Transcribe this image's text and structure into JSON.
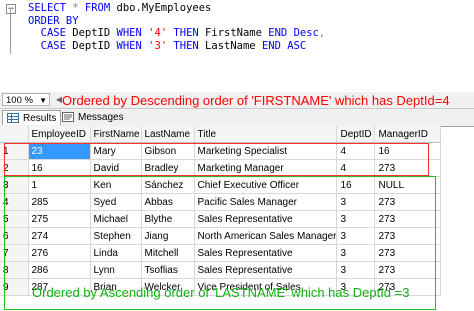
{
  "editor": {
    "line1": [
      "SELECT ",
      "*",
      " FROM ",
      "dbo.MyEmployees"
    ],
    "line2": [
      "ORDER BY"
    ],
    "line3": [
      "  CASE ",
      "DeptID ",
      "WHEN ",
      "'4'",
      " THEN ",
      "FirstName ",
      "END ",
      "Desc",
      ","
    ],
    "line4": [
      "  CASE ",
      "DeptID ",
      "WHEN ",
      "'3'",
      " THEN ",
      "LastName ",
      "END ",
      "ASC"
    ]
  },
  "toolbar": {
    "zoom": "100 %"
  },
  "tabs": [
    {
      "label": "Results",
      "icon": "grid-icon"
    },
    {
      "label": "Messages",
      "icon": "messages-icon"
    }
  ],
  "annotations": {
    "top": "Ordered by Descending order of 'FIRSTNAME' which has  DeptId=4",
    "bottom": "Ordered by Ascending order of 'LASTNAME' which has DeptId =3"
  },
  "grid": {
    "columns": [
      "EmployeeID",
      "FirstName",
      "LastName",
      "Title",
      "DeptID",
      "ManagerID"
    ],
    "rows": [
      [
        "1",
        "23",
        "Mary",
        "Gibson",
        "Marketing Specialist",
        "4",
        "16"
      ],
      [
        "2",
        "16",
        "David",
        "Bradley",
        "Marketing Manager",
        "4",
        "273"
      ],
      [
        "3",
        "1",
        "Ken",
        "Sánchez",
        "Chief Executive Officer",
        "16",
        "NULL"
      ],
      [
        "4",
        "285",
        "Syed",
        "Abbas",
        "Pacific Sales Manager",
        "3",
        "273"
      ],
      [
        "5",
        "275",
        "Michael",
        "Blythe",
        "Sales Representative",
        "3",
        "273"
      ],
      [
        "6",
        "274",
        "Stephen",
        "Jiang",
        "North American Sales Manager",
        "3",
        "273"
      ],
      [
        "7",
        "276",
        "Linda",
        "Mitchell",
        "Sales Representative",
        "3",
        "273"
      ],
      [
        "8",
        "286",
        "Lynn",
        "Tsoflias",
        "Sales Representative",
        "3",
        "273"
      ],
      [
        "9",
        "287",
        "Brian",
        "Welcker",
        "Vice President of Sales",
        "3",
        "273"
      ]
    ]
  },
  "colors": {
    "accent_red": "#ff0000",
    "accent_green": "#10b010",
    "selection": "#3399ff"
  }
}
